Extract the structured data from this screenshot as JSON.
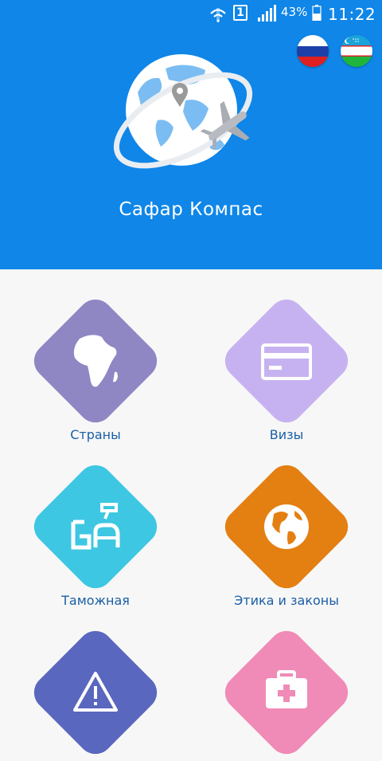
{
  "status_bar": {
    "sim_slot": "1",
    "battery_percent": "43%",
    "time": "11:22",
    "icons": [
      "wifi-icon",
      "sim-icon",
      "signal-icon",
      "battery-icon"
    ]
  },
  "header": {
    "app_title": "Сафар Компас",
    "background_color": "#0f86e8",
    "languages": [
      {
        "name": "russian-flag",
        "colors": [
          "#ffffff",
          "#1c3fa8",
          "#e02020"
        ]
      },
      {
        "name": "uzbek-flag",
        "colors": [
          "#1aa3d9",
          "#ffffff",
          "#1eb53a"
        ]
      }
    ]
  },
  "menu": {
    "items": [
      {
        "label": "Страны",
        "icon": "africa-map-icon",
        "color": "#8f86c4"
      },
      {
        "label": "Визы",
        "icon": "visa-card-icon",
        "color": "#c7b2f1"
      },
      {
        "label": "Таможная",
        "icon": "customs-icon",
        "color": "#3dc7e2"
      },
      {
        "label": "Этика и законы",
        "icon": "globe-icon",
        "color": "#e47f12"
      },
      {
        "label": "",
        "icon": "warning-icon",
        "color": "#5a67bf"
      },
      {
        "label": "",
        "icon": "first-aid-kit-icon",
        "color": "#f08ab7"
      }
    ],
    "label_color": "#1a5fa6"
  }
}
